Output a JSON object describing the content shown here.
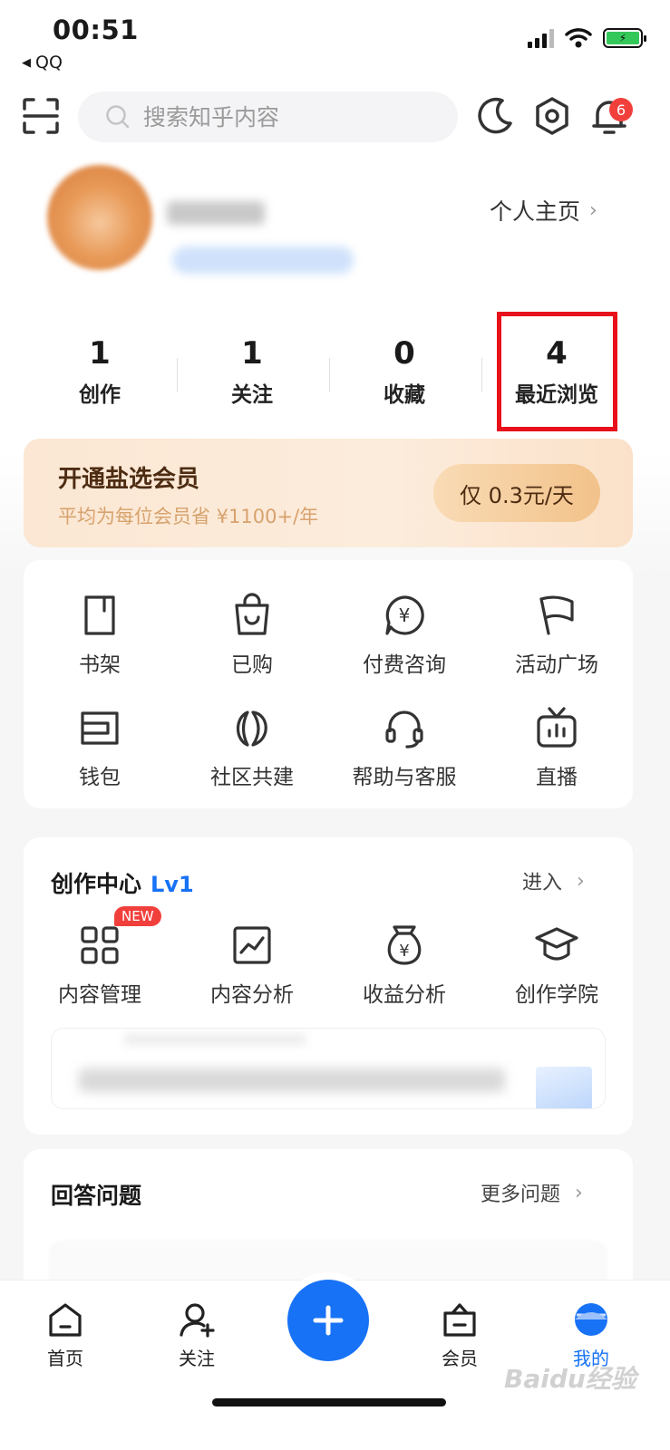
{
  "status_bar": {
    "time": "00:51",
    "back_app": "QQ"
  },
  "search": {
    "placeholder": "搜索知乎内容"
  },
  "notifications": {
    "badge_count": "6"
  },
  "profile": {
    "home_link": "个人主页"
  },
  "stats": [
    {
      "value": "1",
      "label": "创作"
    },
    {
      "value": "1",
      "label": "关注"
    },
    {
      "value": "0",
      "label": "收藏"
    },
    {
      "value": "4",
      "label": "最近浏览"
    }
  ],
  "vip": {
    "title": "开通盐选会员",
    "subtitle": "平均为每位会员省 ¥1100+/年",
    "button": "仅 0.3元/天"
  },
  "services": [
    {
      "label": "书架",
      "icon": "bookshelf-icon"
    },
    {
      "label": "已购",
      "icon": "shopping-bag-icon"
    },
    {
      "label": "付费咨询",
      "icon": "paid-consult-icon"
    },
    {
      "label": "活动广场",
      "icon": "flag-icon"
    },
    {
      "label": "钱包",
      "icon": "wallet-icon"
    },
    {
      "label": "社区共建",
      "icon": "community-icon"
    },
    {
      "label": "帮助与客服",
      "icon": "headset-icon"
    },
    {
      "label": "直播",
      "icon": "live-tv-icon"
    }
  ],
  "creator": {
    "title": "创作中心",
    "level": "Lv1",
    "enter": "进入",
    "new_badge": "NEW",
    "items": [
      {
        "label": "内容管理",
        "icon": "grid-icon"
      },
      {
        "label": "内容分析",
        "icon": "chart-icon"
      },
      {
        "label": "收益分析",
        "icon": "money-bag-icon"
      },
      {
        "label": "创作学院",
        "icon": "graduation-cap-icon"
      }
    ]
  },
  "answer": {
    "title": "回答问题",
    "more": "更多问题"
  },
  "tabbar": [
    {
      "label": "首页",
      "icon": "home-icon"
    },
    {
      "label": "关注",
      "icon": "follow-icon"
    },
    {
      "label": "会员",
      "icon": "vip-icon"
    },
    {
      "label": "我的",
      "icon": "me-icon"
    }
  ],
  "watermark": "Baidu经验",
  "colors": {
    "accent": "#1772f6",
    "highlight_box": "#e8101a",
    "badge": "#f1403c"
  }
}
